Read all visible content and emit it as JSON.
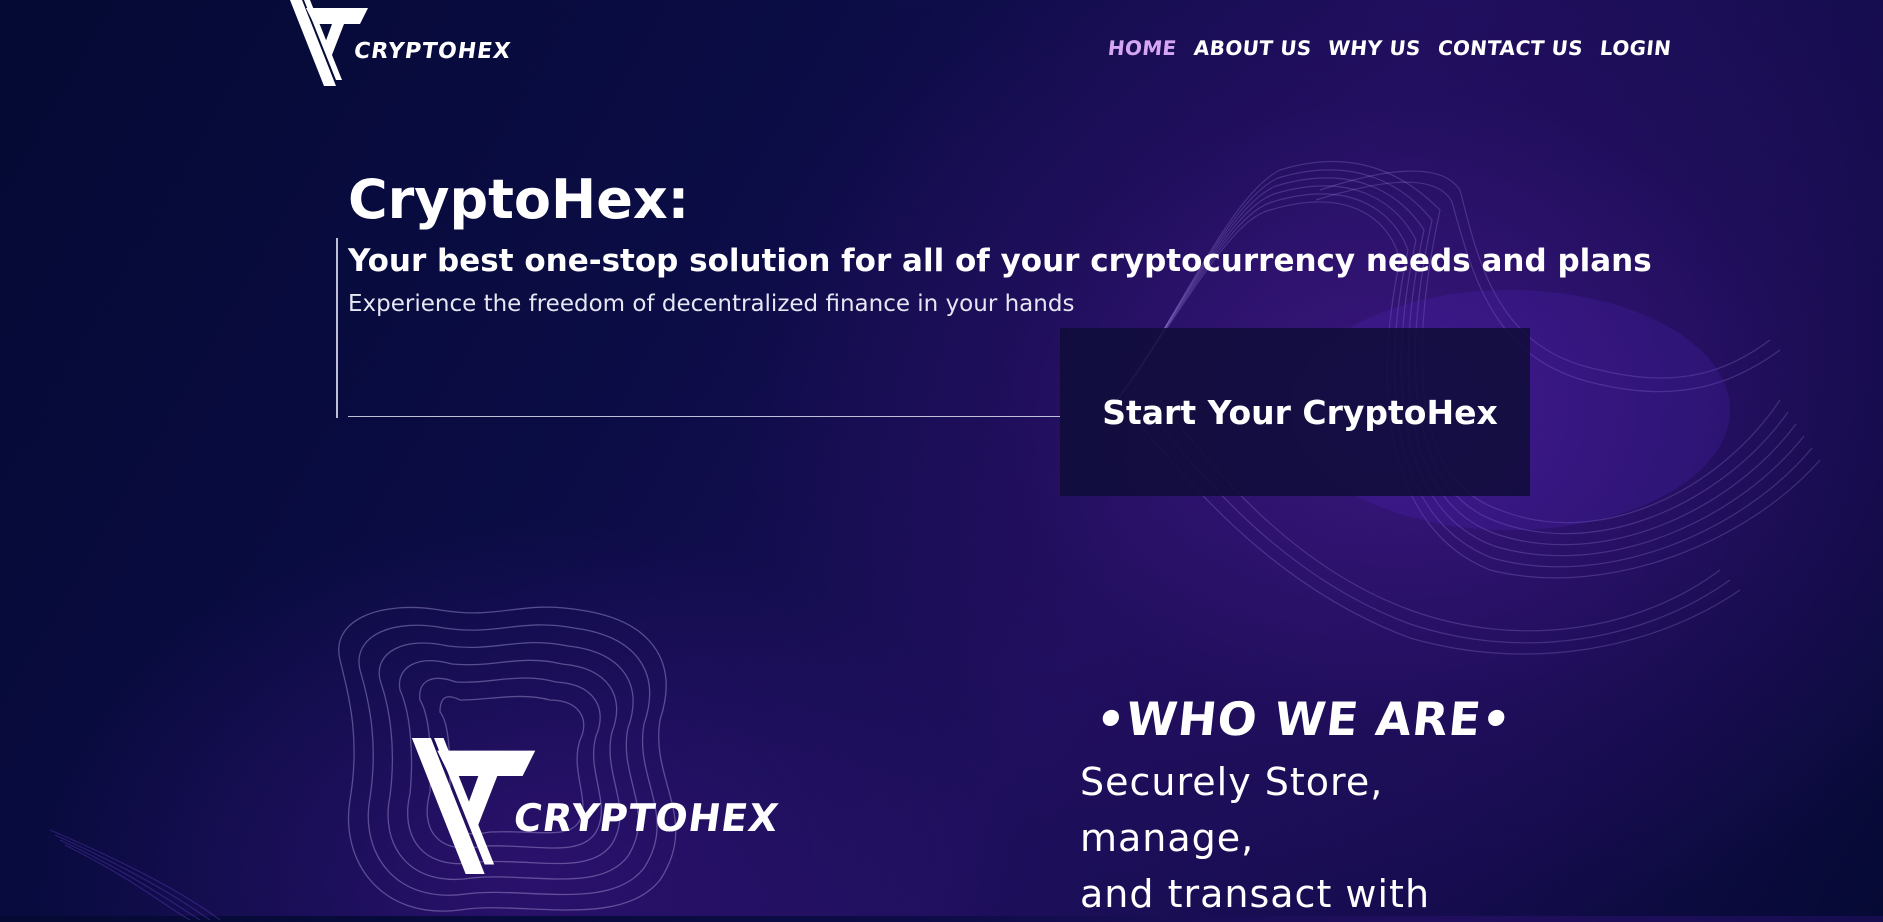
{
  "header": {
    "logo_text": "CRYPTOHEX",
    "nav": [
      {
        "label": "HOME",
        "active": true
      },
      {
        "label": "ABOUT US"
      },
      {
        "label": "WHY US"
      },
      {
        "label": "CONTACT US"
      },
      {
        "label": "LOGIN"
      }
    ]
  },
  "hero": {
    "title": "CryptoHex:",
    "tagline": "Your best one-stop solution for all of your cryptocurrency needs and plans",
    "subtitle": "Experience the freedom of decentralized finance in your hands",
    "cta_label": "Start Your CryptoHex"
  },
  "about": {
    "logo_text": "CRYPTOHEX",
    "section_title": "•WHO WE ARE•",
    "lines": [
      "Securely Store,",
      "manage,",
      "and transact with"
    ]
  },
  "colors": {
    "accent_nav_active": "#d7a6f3",
    "background_dark": "#040a33",
    "background_purple": "#1e0f5c"
  }
}
